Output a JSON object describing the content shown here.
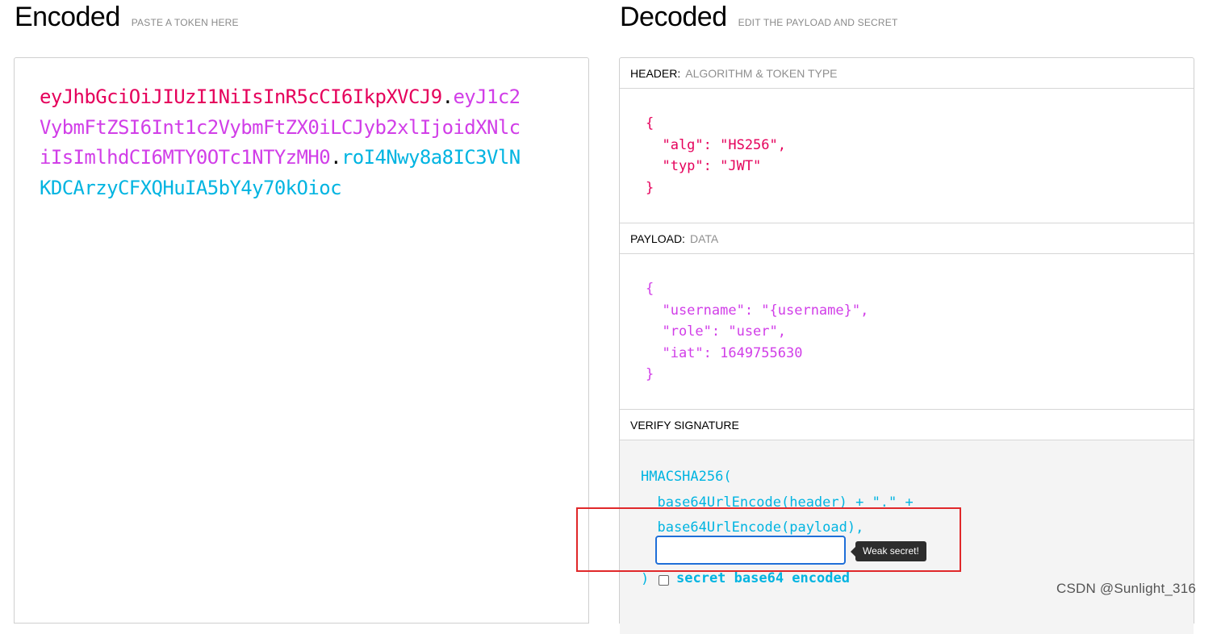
{
  "encoded": {
    "title": "Encoded",
    "subtitle": "PASTE A TOKEN HERE",
    "token": {
      "header": "eyJhbGciOiJIUzI1NiIsInR5cCI6IkpXVCJ9",
      "dot1": ".",
      "payload": "eyJ1c2VybmFtZSI6Int1c2VybmFtZX0iLCJyb2xlIjoidXNlciIsImlhdCI6MTY0OTc1NTYzMH0",
      "dot2": ".",
      "signature": "roI4Nwy8a8IC3VlNKDCArzyCFXQHuIA5bY4y70kOioc"
    }
  },
  "decoded": {
    "title": "Decoded",
    "subtitle": "EDIT THE PAYLOAD AND SECRET",
    "header_section": {
      "label": "HEADER:",
      "sublabel": "ALGORITHM & TOKEN TYPE",
      "json": "{\n  \"alg\": \"HS256\",\n  \"typ\": \"JWT\"\n}"
    },
    "payload_section": {
      "label": "PAYLOAD:",
      "sublabel": "DATA",
      "json": "{\n  \"username\": \"{username}\",\n  \"role\": \"user\",\n  \"iat\": 1649755630\n}"
    },
    "verify_section": {
      "label": "VERIFY SIGNATURE",
      "code": "HMACSHA256(\n  base64UrlEncode(header) + \".\" +\n  base64UrlEncode(payload),",
      "secret_value": "",
      "tooltip": "Weak secret!",
      "closing": ")",
      "checkbox_label": "secret base64 encoded",
      "checkbox_checked": false
    }
  },
  "watermark": "CSDN @Sunlight_316",
  "colors": {
    "header": "#e5005b",
    "payload": "#d13ee8",
    "signature": "#00b4e1",
    "highlight_box": "#e0282a"
  }
}
